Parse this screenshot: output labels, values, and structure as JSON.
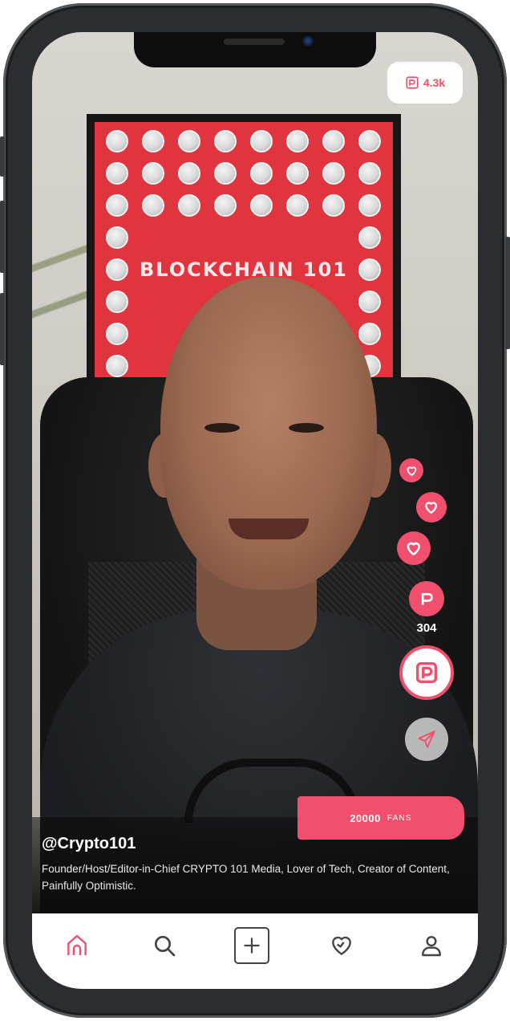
{
  "status": {
    "badge_count": "4.3k",
    "badge_icon": "patreon-badge-icon"
  },
  "poster": {
    "title": "BLOCKCHAIN 101"
  },
  "actions": {
    "support_count": "304",
    "icons": [
      "heart-small-icon",
      "heart-medium-icon",
      "heart-large-icon",
      "patreon-icon",
      "patreon-large-icon",
      "share-send-icon"
    ]
  },
  "creator": {
    "username": "@Crypto101",
    "bio": "Founder/Host/Editor-in-Chief CRYPTO 101 Media, Lover of Tech, Creator of Content, Painfully Optimistic.",
    "fans_count": "20000",
    "fans_label": "FANS"
  },
  "tabs": [
    {
      "icon": "home-icon",
      "active": true
    },
    {
      "icon": "search-icon",
      "active": false
    },
    {
      "icon": "create-icon",
      "active": false
    },
    {
      "icon": "likes-heart-icon",
      "active": false
    },
    {
      "icon": "profile-icon",
      "active": false
    }
  ],
  "colors": {
    "accent": "#f0506e",
    "tabbar_bg": "#ffffff",
    "icon_default": "#444444"
  }
}
